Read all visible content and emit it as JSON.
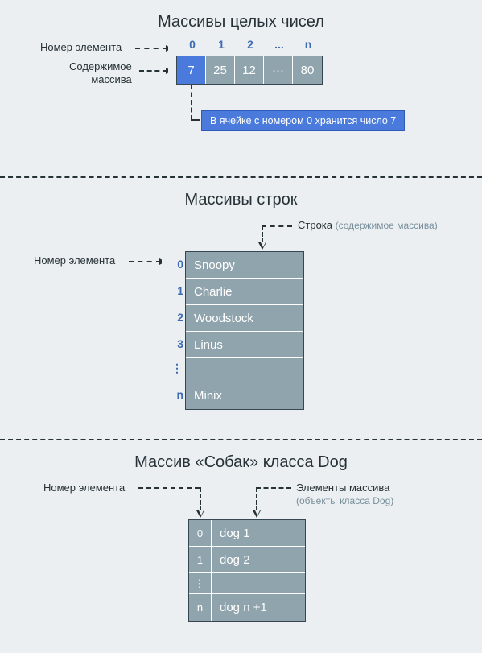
{
  "section1": {
    "title": "Массивы целых чисел",
    "index_label": "Номер элемента",
    "content_label": "Содержимое\nмассива",
    "indices": [
      "0",
      "1",
      "2",
      "...",
      "n"
    ],
    "cells": [
      "7",
      "25",
      "12",
      "···",
      "80"
    ],
    "callout": "В ячейке с номером 0 хранится число 7"
  },
  "section2": {
    "title": "Массивы строк",
    "top_label": "Строка",
    "top_label_paren": "(содержимое массива)",
    "left_label": "Номер элемента",
    "rows": [
      {
        "idx": "0",
        "val": "Snoopy"
      },
      {
        "idx": "1",
        "val": "Charlie"
      },
      {
        "idx": "2",
        "val": "Woodstock"
      },
      {
        "idx": "3",
        "val": "Linus"
      },
      {
        "idx": "⋮",
        "val": ""
      },
      {
        "idx": "n",
        "val": "Minix"
      }
    ]
  },
  "section3": {
    "title": "Массив «Собак» класса Dog",
    "left_label": "Номер элемента",
    "right_label": "Элементы массива",
    "right_label_paren": "(объекты класса Dog)",
    "rows": [
      {
        "idx": "0",
        "val": "dog 1"
      },
      {
        "idx": "1",
        "val": "dog 2"
      },
      {
        "idx": "⋮",
        "val": ""
      },
      {
        "idx": "n",
        "val": "dog n +1"
      }
    ]
  }
}
